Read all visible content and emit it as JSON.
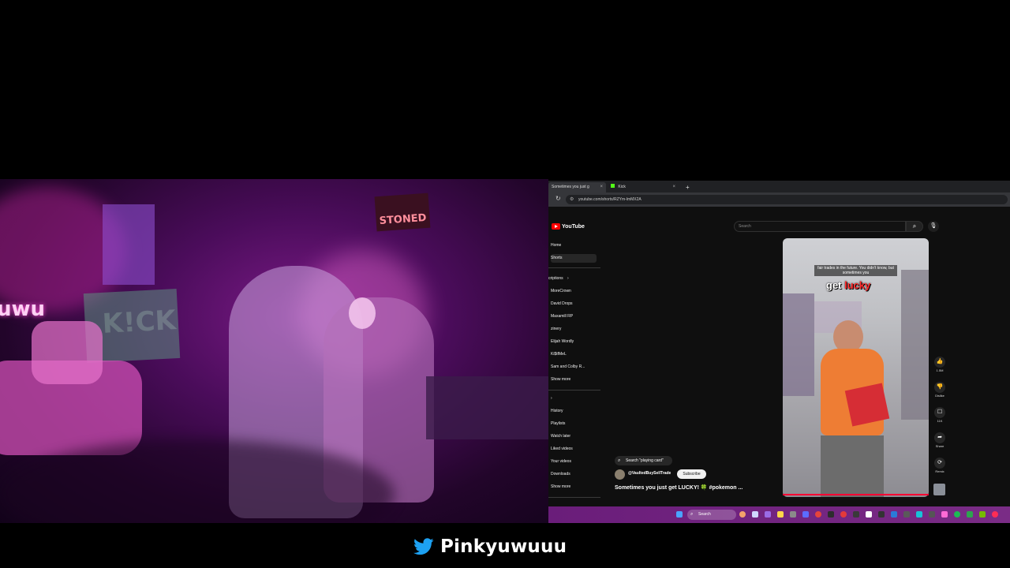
{
  "browser": {
    "tabs": [
      {
        "label": "Sometimes you just g",
        "active": true
      },
      {
        "label": "Kick",
        "active": false
      }
    ],
    "new_tab_icon": "plus-icon",
    "url": "youtube.com/shorts/RZYm-lmMX2A"
  },
  "youtube": {
    "logo_text": "YouTube",
    "search_placeholder": "Search",
    "sidebar": {
      "top": [
        {
          "label": "Home",
          "active": false
        },
        {
          "label": "Shorts",
          "active": true
        }
      ],
      "subscriptions_header": "criptions",
      "subscriptions": [
        "MoreCrown",
        "David Drops",
        "Maxamill RP",
        "zinery",
        "Elijah Wordly",
        "Ki$tfMeL",
        "Sam and Colby R..."
      ],
      "show_more_1": "Show more",
      "you_items": [
        "History",
        "Playlists",
        "Watch later",
        "Liked videos",
        "Your videos",
        "Downloads"
      ],
      "show_more_2": "Show more"
    },
    "short": {
      "caption": "fair trades in the future. You didn't know, but sometimes you",
      "overlay_white": "get",
      "overlay_red": "lucky",
      "search_suggestion": "Search \"playing card\"",
      "channel": "@VaultedBuySellTrade",
      "subscribe_label": "Subscribe",
      "title": "Sometimes you just get LUCKY! 🍀 #pokemon ..."
    },
    "actions": [
      {
        "icon": "like-icon",
        "label": "1.5M"
      },
      {
        "icon": "dislike-icon",
        "label": "Dislike"
      },
      {
        "icon": "comment-icon",
        "label": "11K"
      },
      {
        "icon": "share-icon",
        "label": "Share"
      },
      {
        "icon": "remix-icon",
        "label": "Remix"
      }
    ]
  },
  "taskbar": {
    "search_label": "Search"
  },
  "footer": {
    "twitter_handle": "Pinkyuwuuu"
  },
  "colors": {
    "youtube_red": "#ff0000",
    "twitter_blue": "#1da1f2",
    "neon_pink": "#ff4fd8",
    "taskbar_purple": "#6a1d7a"
  }
}
